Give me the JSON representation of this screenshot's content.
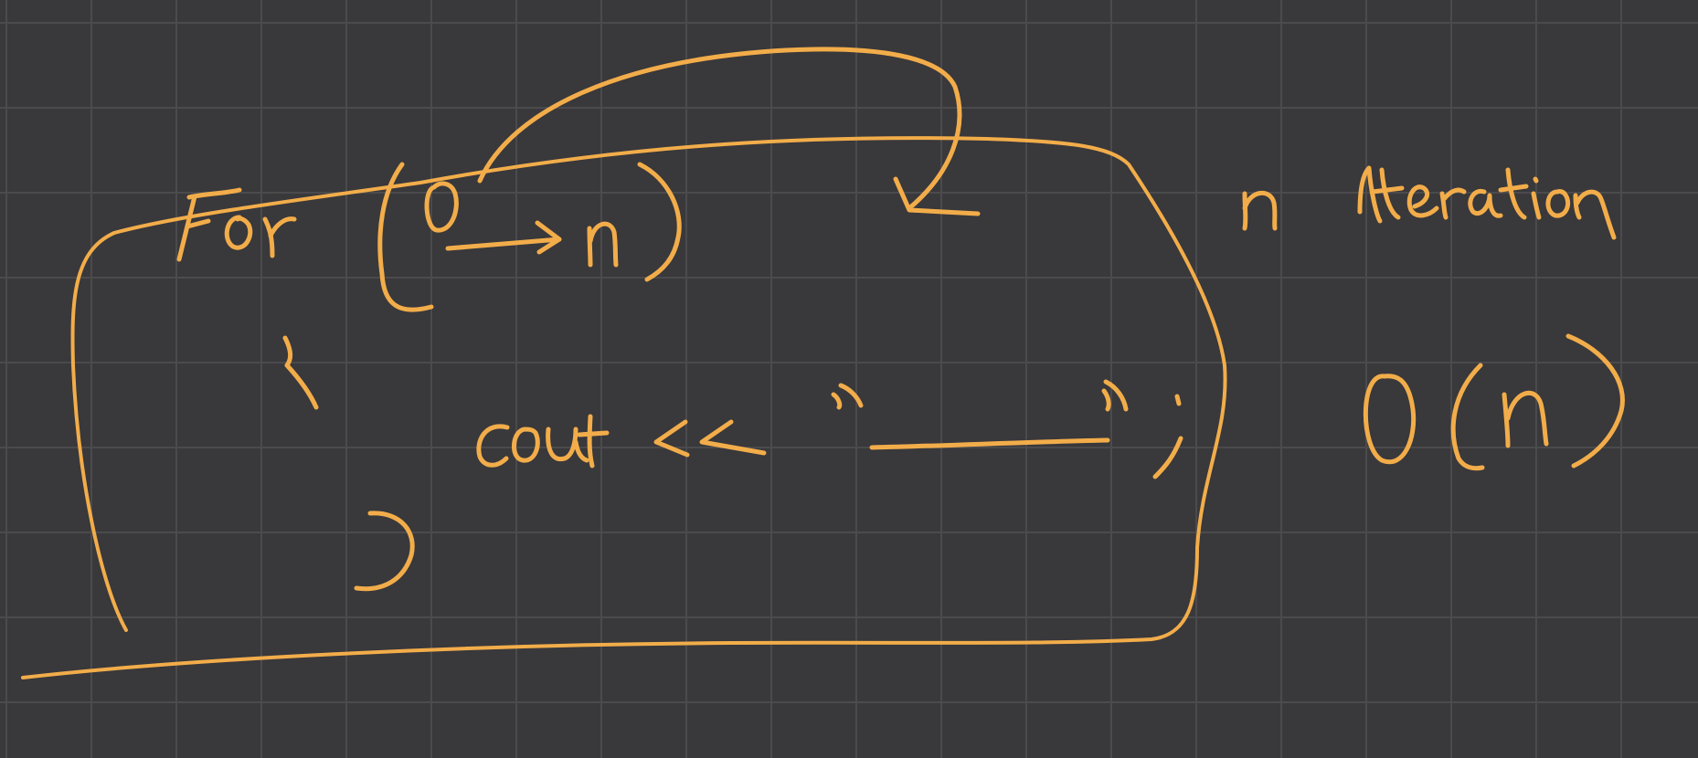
{
  "canvas": {
    "background": "#39383b",
    "grid_color": "#4b4a4d",
    "ink_color": "#f2ad4a"
  },
  "loop_header": {
    "keyword": "For",
    "range_start": "0",
    "range_end": "n"
  },
  "loop_body": {
    "statement": "cout << \"______\";"
  },
  "annotations": {
    "iterations": "n iteration",
    "complexity": "O(n)"
  }
}
